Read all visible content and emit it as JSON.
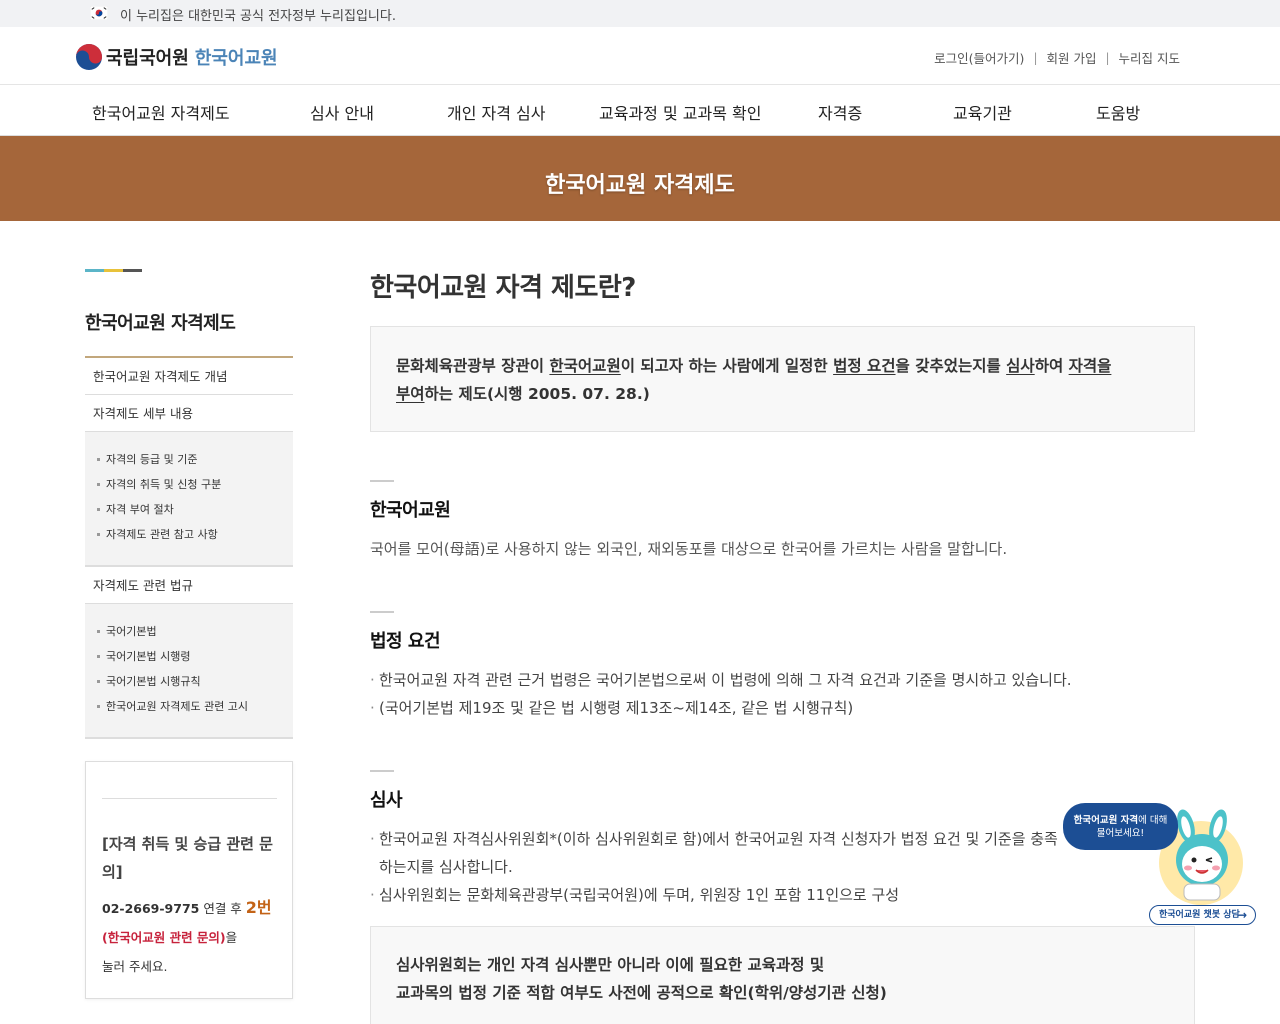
{
  "gov_banner": {
    "text": "이 누리집은 대한민국 공식 전자정부 누리집입니다."
  },
  "logo": {
    "org": "국립국어원",
    "site": "한국어교원"
  },
  "util_links": [
    "로그인(들어가기)",
    "회원 가입",
    "누리집 지도"
  ],
  "gnb": [
    "한국어교원 자격제도",
    "심사 안내",
    "개인 자격 심사",
    "교육과정 및 교과목 확인",
    "자격증",
    "교육기관",
    "도움방"
  ],
  "hero": {
    "title": "한국어교원 자격제도"
  },
  "sidebar": {
    "title": "한국어교원 자격제도",
    "menu": {
      "concept": "한국어교원 자격제도 개념",
      "detail": "자격제도 세부 내용",
      "detail_sub": [
        "자격의 등급 및 기준",
        "자격의 취득 및 신청 구분",
        "자격 부여 절차",
        "자격제도 관련 참고 사항"
      ],
      "law": "자격제도 관련 법규",
      "law_sub": [
        "국어기본법",
        "국어기본법 시행령",
        "국어기본법 시행규칙",
        "한국어교원 자격제도 관련 고시"
      ]
    },
    "inquiry": {
      "title": "[자격 취득 및 승급 관련 문의]",
      "phone": "02-2669-9775",
      "connect": " 연결 후 ",
      "ext": "2번",
      "category": "(한국어교원 관련 문의)",
      "suffix": "을",
      "press": "눌러 주세요."
    }
  },
  "main": {
    "title": "한국어교원 자격 제도란?",
    "definition": {
      "p1": "문화체육관광부 장관이 ",
      "u1": "한국어교원",
      "p2": "이 되고자 하는 사람에게 일정한 ",
      "u2": "법정 요건",
      "p3": "을 갖추었는지를 ",
      "u3": "심사",
      "p4": "하여 ",
      "u4a": "자격을",
      "u4b": "부여",
      "p5": "하는 제도(시행 2005. 07. 28.)"
    },
    "sections": {
      "teacher": {
        "title": "한국어교원",
        "text": "국어를 모어(母語)로 사용하지 않는 외국인, 재외동포를 대상으로 한국어를 가르치는 사람을 말합니다."
      },
      "legal": {
        "title": "법정 요건",
        "items": [
          "한국어교원 자격 관련 근거 법령은 국어기본법으로써 이 법령에 의해 그 자격 요건과 기준을 명시하고 있습니다.",
          "(국어기본법 제19조 및 같은 법 시행령 제13조~제14조, 같은 법 시행규칙)"
        ]
      },
      "review": {
        "title": "심사",
        "items": [
          "한국어교원 자격심사위원회*(이하 심사위원회로 함)에서 한국어교원 자격 신청자가 법정 요건 및 기준을 충족하는지를 심사합니다.",
          "심사위원회는 문화체육관광부(국립국어원)에 두며, 위원장 1인 포함 11인으로 구성"
        ],
        "note_line1": "심사위원회는 개인 자격 심사뿐만 아니라 이에 필요한 교육과정 및",
        "note_line2": "교과목의 법정 기준 적합 여부도 사전에 공적으로 확인(학위/양성기관 신청)"
      }
    }
  },
  "chatbot": {
    "bubble_bold": "한국어교원 자격",
    "bubble_rest": "에 대해",
    "bubble_line2": "물어보세요!",
    "button": "한국어교원 챗봇 상담"
  },
  "colors": {
    "hero": "#a5663a",
    "brand_blue": "#4b84b7",
    "chat_blue": "#1c4e94",
    "accent_orange": "#c36317",
    "accent_red": "#c7223c"
  }
}
